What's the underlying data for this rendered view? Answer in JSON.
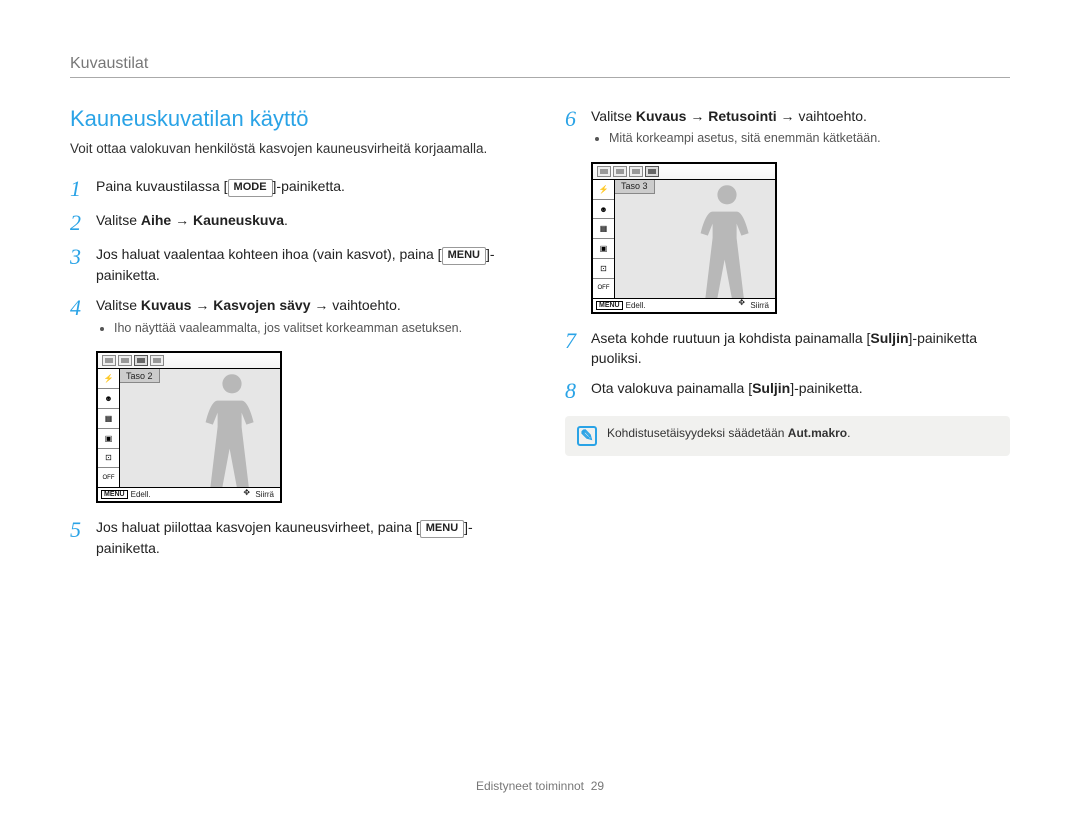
{
  "section_label": "Kuvaustilat",
  "title": "Kauneuskuvatilan käyttö",
  "intro": "Voit ottaa valokuvan henkilöstä kasvojen kauneusvirheitä korjaamalla.",
  "keys": {
    "mode": "MODE",
    "menu": "MENU",
    "suljin": "Suljin"
  },
  "steps": {
    "1": {
      "pre": "Paina kuvaustilassa [",
      "post": "]-painiketta."
    },
    "2": {
      "text_a": "Valitse ",
      "bold": "Aihe → Kauneuskuva",
      "text_b": "."
    },
    "3": {
      "text_a": "Jos haluat vaalentaa kohteen ihoa (vain kasvot), paina [",
      "text_b": "]-painiketta."
    },
    "4": {
      "text_a": "Valitse ",
      "bold": "Kuvaus → Kasvojen sävy",
      "text_b": " → vaihtoehto.",
      "sub": "Iho näyttää vaaleammalta, jos valitset korkeamman asetuksen."
    },
    "5": {
      "text_a": "Jos haluat piilottaa kasvojen kauneusvirheet, paina [",
      "text_b": "]-painiketta."
    },
    "6": {
      "text_a": "Valitse ",
      "bold": "Kuvaus → Retusointi",
      "text_b": " → vaihtoehto.",
      "sub": "Mitä korkeampi asetus, sitä enemmän kätketään."
    },
    "7": {
      "text_a": "Aseta kohde ruutuun ja kohdista painamalla [",
      "bold": "Suljin",
      "text_b": "]-painiketta puoliksi."
    },
    "8": {
      "text_a": "Ota valokuva painamalla [",
      "bold": "Suljin",
      "text_b": "]-painiketta."
    }
  },
  "screens": {
    "a": {
      "level": "Taso 2",
      "back": "Edell.",
      "move": "Siirrä"
    },
    "b": {
      "level": "Taso 3",
      "back": "Edell.",
      "move": "Siirrä"
    }
  },
  "note": {
    "icon": "✎",
    "text_a": "Kohdistusetäisyydeksi säädetään ",
    "bold": "Aut.makro",
    "text_b": "."
  },
  "footer": {
    "label": "Edistyneet toiminnot",
    "page": "29"
  }
}
